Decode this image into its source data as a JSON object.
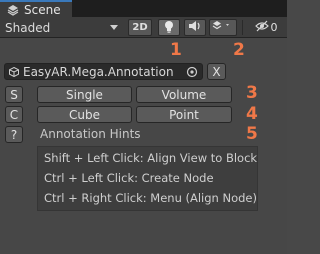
{
  "window": {
    "tab_label": "Scene"
  },
  "toolbar": {
    "shading_mode": "Shaded",
    "mode_2d_label": "2D",
    "hidden_count": "0"
  },
  "panel": {
    "annotation_path": "EasyAR.Mega.Annotation",
    "clear_label": "X",
    "row_s": {
      "key": "S",
      "left": "Single",
      "right": "Volume"
    },
    "row_c": {
      "key": "C",
      "left": "Cube",
      "right": "Point"
    },
    "help_key": "?",
    "hints_title": "Annotation Hints",
    "hints": [
      "Shift + Left Click: Align View to Block",
      "Ctrl + Left Click: Create Node",
      "Ctrl + Right Click: Menu (Align Node)"
    ]
  },
  "markers": [
    "1",
    "2",
    "3",
    "4",
    "5"
  ],
  "colors": {
    "accent": "#3a79bb",
    "marker": "#f07848"
  },
  "icons": [
    "scene-icon",
    "light-bulb-icon",
    "audio-icon",
    "effects-icon",
    "visibility-icon",
    "gameobject-icon",
    "target-icon"
  ]
}
